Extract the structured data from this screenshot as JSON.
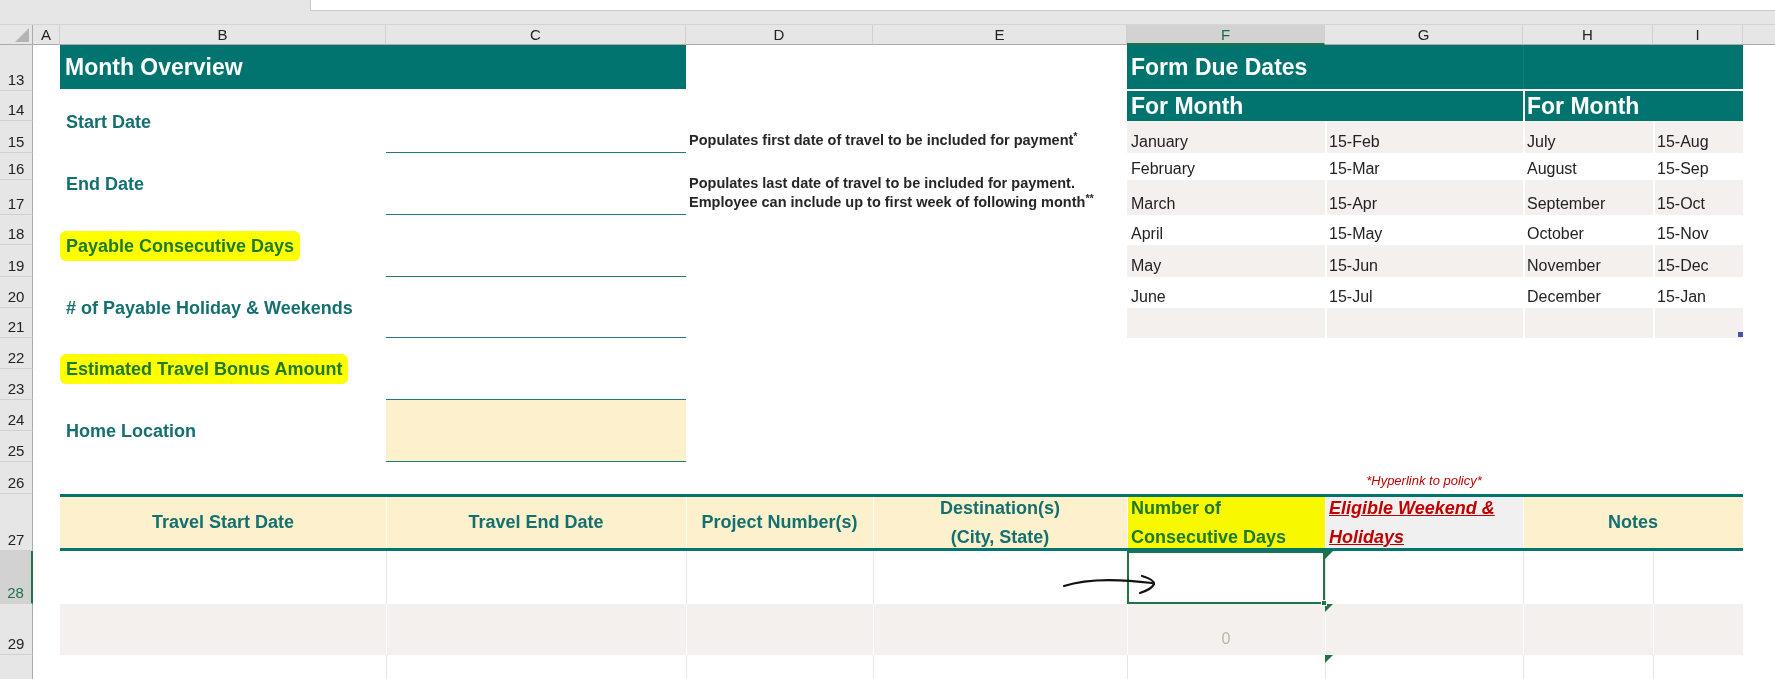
{
  "column_headers": [
    {
      "label": "A",
      "selected": false
    },
    {
      "label": "B",
      "selected": false
    },
    {
      "label": "C",
      "selected": false
    },
    {
      "label": "D",
      "selected": false
    },
    {
      "label": "E",
      "selected": false
    },
    {
      "label": "F",
      "selected": true
    },
    {
      "label": "G",
      "selected": false
    },
    {
      "label": "H",
      "selected": false
    },
    {
      "label": "I",
      "selected": false
    }
  ],
  "row_headers": [
    {
      "label": "13",
      "selected": false
    },
    {
      "label": "14",
      "selected": false
    },
    {
      "label": "15",
      "selected": false
    },
    {
      "label": "16",
      "selected": false
    },
    {
      "label": "17",
      "selected": false
    },
    {
      "label": "18",
      "selected": false
    },
    {
      "label": "19",
      "selected": false
    },
    {
      "label": "20",
      "selected": false
    },
    {
      "label": "21",
      "selected": false
    },
    {
      "label": "22",
      "selected": false
    },
    {
      "label": "23",
      "selected": false
    },
    {
      "label": "24",
      "selected": false
    },
    {
      "label": "25",
      "selected": false
    },
    {
      "label": "26",
      "selected": false
    },
    {
      "label": "27",
      "selected": false
    },
    {
      "label": "28",
      "selected": true
    },
    {
      "label": "29",
      "selected": false
    }
  ],
  "month_overview": {
    "title": "Month Overview",
    "fields": [
      {
        "label": "Start Date",
        "highlighted": false,
        "kind": "line",
        "note": "Populates first date of travel to be included for payment$^{*}$"
      },
      {
        "label": "End Date",
        "highlighted": false,
        "kind": "line",
        "note": "Populates last date of travel to be included for payment. Employee can include up to first week of following month$^{**}$"
      },
      {
        "label": "Payable Consecutive Days",
        "highlighted": true,
        "kind": "line"
      },
      {
        "label": "# of Payable Holiday & Weekends",
        "highlighted": false,
        "kind": "line"
      },
      {
        "label": "Estimated Travel Bonus Amount",
        "highlighted": true,
        "kind": "line"
      },
      {
        "label": "Home Location",
        "highlighted": false,
        "kind": "shaded"
      }
    ]
  },
  "form_due_dates": {
    "title": "Form Due Dates",
    "groups": [
      {
        "heading": "For Month",
        "rows": [
          {
            "month": "January",
            "due": "15-Feb"
          },
          {
            "month": "February",
            "due": "15-Mar"
          },
          {
            "month": "March",
            "due": "15-Apr"
          },
          {
            "month": "April",
            "due": "15-May"
          },
          {
            "month": "May",
            "due": "15-Jun"
          },
          {
            "month": "June",
            "due": "15-Jul"
          }
        ]
      },
      {
        "heading": "For Month",
        "rows": [
          {
            "month": "July",
            "due": "15-Aug"
          },
          {
            "month": "August",
            "due": "15-Sep"
          },
          {
            "month": "September",
            "due": "15-Oct"
          },
          {
            "month": "October",
            "due": "15-Nov"
          },
          {
            "month": "November",
            "due": "15-Dec"
          },
          {
            "month": "December",
            "due": "15-Jan"
          }
        ]
      }
    ]
  },
  "travel_table": {
    "note": "*Hyperlink to policy*",
    "columns": [
      {
        "label": "Travel Start Date",
        "kind": "text",
        "highlighted": false
      },
      {
        "label": "Travel End Date",
        "kind": "text",
        "highlighted": false
      },
      {
        "label": "Project Number(s)",
        "kind": "text",
        "highlighted": false
      },
      {
        "label": "Destination(s)\n(City, State)",
        "kind": "text",
        "highlighted": false
      },
      {
        "label": "Number of\nConsecutive Days",
        "kind": "text",
        "highlighted": true
      },
      {
        "label": "Eligible Weekend &\nHolidays",
        "kind": "link",
        "highlighted": false
      },
      {
        "label": "Notes",
        "kind": "text",
        "highlighted": false
      }
    ],
    "rows": [
      {
        "cells": [
          {
            "selected": false,
            "flagged": false
          },
          {
            "selected": false,
            "flagged": false
          },
          {
            "selected": false,
            "flagged": false
          },
          {
            "selected": false,
            "flagged": false
          },
          {
            "selected": true,
            "flagged": false
          },
          {
            "selected": false,
            "flagged": true
          },
          {
            "selected": false,
            "flagged": false
          },
          {
            "selected": false,
            "flagged": false
          }
        ]
      },
      {
        "cells": [
          {
            "selected": false,
            "flagged": false
          },
          {
            "selected": false,
            "flagged": false
          },
          {
            "selected": false,
            "flagged": false
          },
          {
            "selected": false,
            "flagged": false
          },
          {
            "selected": false,
            "flagged": false,
            "value": "0"
          },
          {
            "selected": false,
            "flagged": true
          },
          {
            "selected": false,
            "flagged": false
          },
          {
            "selected": false,
            "flagged": false
          }
        ]
      },
      {
        "cells": [
          {
            "selected": false,
            "flagged": false
          },
          {
            "selected": false,
            "flagged": false
          },
          {
            "selected": false,
            "flagged": false
          },
          {
            "selected": false,
            "flagged": false
          },
          {
            "selected": false,
            "flagged": false
          },
          {
            "selected": false,
            "flagged": true
          },
          {
            "selected": false,
            "flagged": false
          },
          {
            "selected": false,
            "flagged": false
          }
        ]
      }
    ]
  }
}
